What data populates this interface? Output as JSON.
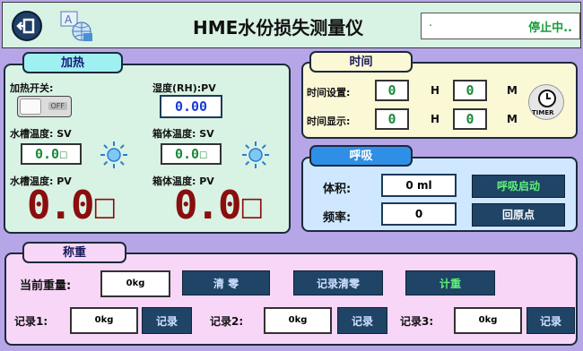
{
  "header": {
    "title": "HME水份损失测量仪",
    "status_left": ".",
    "status_text": "停止中.."
  },
  "heating": {
    "tag": "加热",
    "switch_label": "加热开关:",
    "switch_state": "OFF",
    "humidity_label": "湿度(RH):PV",
    "humidity_value": "0.00",
    "tank_sv_label": "水槽温度: SV",
    "tank_sv_value": "0.0☐",
    "box_sv_label": "箱体温度: SV",
    "box_sv_value": "0.0☐",
    "tank_pv_label": "水槽温度: PV",
    "tank_pv_value": "0.0☐",
    "box_pv_label": "箱体温度: PV",
    "box_pv_value": "0.0☐"
  },
  "time": {
    "tag": "时间",
    "set_label": "时间设置:",
    "display_label": "时间显示:",
    "set_hours": "0",
    "set_minutes": "0",
    "display_hours": "0",
    "display_minutes": "0",
    "h_unit": "H",
    "m_unit": "M",
    "timer_label": "TIMER"
  },
  "breath": {
    "tag": "呼吸",
    "volume_label": "体积:",
    "volume_value": "0 ml",
    "freq_label": "频率:",
    "freq_value": "0",
    "start_button": "呼吸启动",
    "home_button": "回原点"
  },
  "weigh": {
    "tag": "称重",
    "current_label": "当前重量:",
    "current_value": "0kg",
    "clear_button": "清 零",
    "record_clear_button": "记录清零",
    "weigh_button": "计重",
    "records": [
      {
        "label": "记录1:",
        "value": "0kg",
        "button": "记录"
      },
      {
        "label": "记录2:",
        "value": "0kg",
        "button": "记录"
      },
      {
        "label": "记录3:",
        "value": "0kg",
        "button": "记录"
      }
    ]
  },
  "colors": {
    "background": "#b6a6e8",
    "panel_green": "#d8f2e4",
    "digit_red": "#8a0e0e",
    "digit_green": "#1a8a3a",
    "dark_button": "#1f4466",
    "accent_blue": "#2f8fe6"
  }
}
